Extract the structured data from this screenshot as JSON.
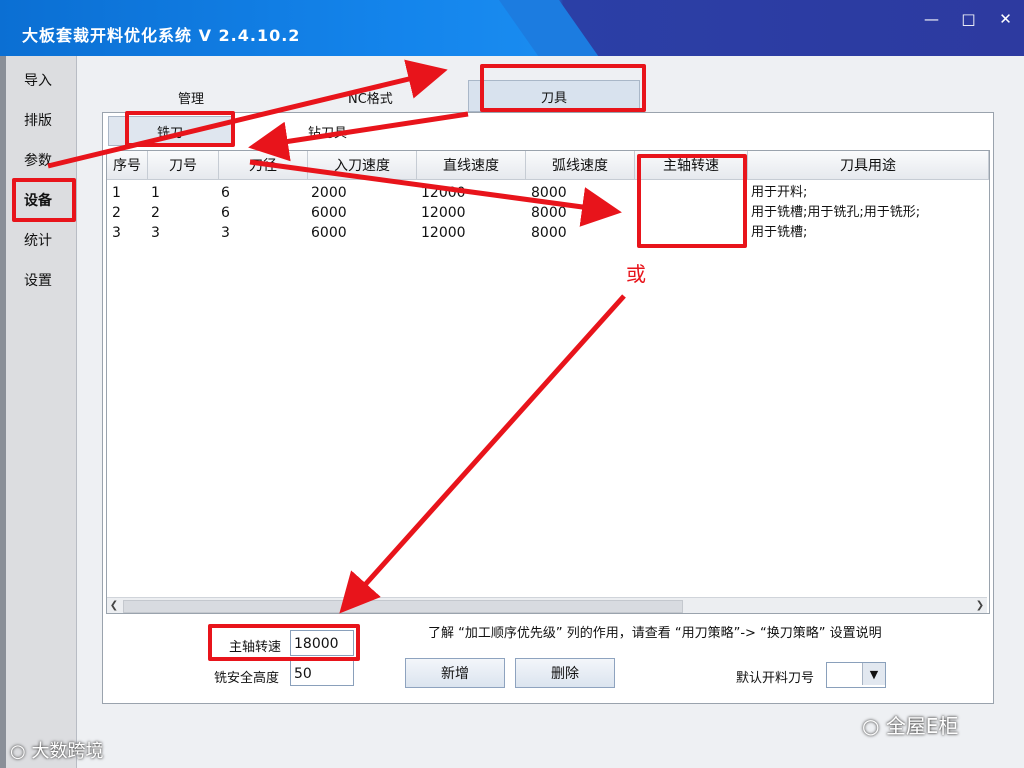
{
  "window": {
    "title": "大板套裁开料优化系统 V 2.4.10.2"
  },
  "sidebar": {
    "items": [
      {
        "label": "导入"
      },
      {
        "label": "排版"
      },
      {
        "label": "参数"
      },
      {
        "label": "设备"
      },
      {
        "label": "统计"
      },
      {
        "label": "设置"
      }
    ]
  },
  "top_tabs": [
    {
      "label": "管理"
    },
    {
      "label": "NC格式"
    },
    {
      "label": "刀具"
    }
  ],
  "sub_tabs": [
    {
      "label": "铣刀"
    },
    {
      "label": "钻刀具"
    }
  ],
  "grid": {
    "columns": [
      "序号",
      "刀号",
      "刀径",
      "入刀速度",
      "直线速度",
      "弧线速度",
      "主轴转速",
      "刀具用途"
    ],
    "rows": [
      {
        "c0": "1",
        "c1": "1",
        "c2": "6",
        "c3": "2000",
        "c4": "12000",
        "c5": "8000",
        "c6": "",
        "c7": "用于开料;"
      },
      {
        "c0": "2",
        "c1": "2",
        "c2": "6",
        "c3": "6000",
        "c4": "12000",
        "c5": "8000",
        "c6": "",
        "c7": "用于铣槽;用于铣孔;用于铣形;"
      },
      {
        "c0": "3",
        "c1": "3",
        "c2": "3",
        "c3": "6000",
        "c4": "12000",
        "c5": "8000",
        "c6": "",
        "c7": "用于铣槽;"
      }
    ]
  },
  "form": {
    "spindle_label": "主轴转速",
    "spindle_value": "18000",
    "safe_height_label": "铣安全高度",
    "safe_height_value": "50",
    "add_button": "新增",
    "delete_button": "删除",
    "note": "了解 “加工顺序优先级” 列的作用，请查看 “用刀策略”-> “换刀策略” 设置说明",
    "default_tool_label": "默认开料刀号",
    "default_tool_value": ""
  },
  "annotation": {
    "or_text": "或",
    "color": "#e8141b"
  },
  "watermarks": {
    "left": "大数跨境",
    "right": "全屋E柜"
  },
  "icons": {
    "minimize": "minimize-icon",
    "maximize": "maximize-icon",
    "close": "close-icon",
    "dropdown": "chevron-down-icon"
  }
}
